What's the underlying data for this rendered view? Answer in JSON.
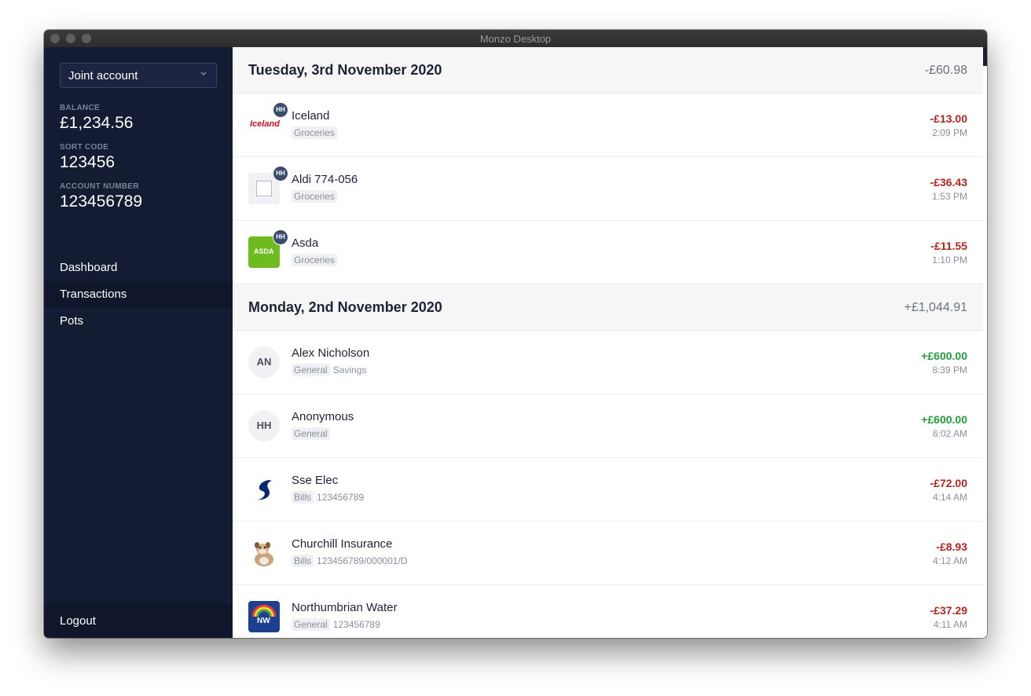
{
  "window": {
    "title": "Monzo Desktop"
  },
  "sidebar": {
    "account_select": "Joint account",
    "balance_label": "BALANCE",
    "balance_value": "£1,234.56",
    "sort_code_label": "SORT CODE",
    "sort_code_value": "123456",
    "account_number_label": "ACCOUNT NUMBER",
    "account_number_value": "123456789",
    "nav": [
      {
        "label": "Dashboard"
      },
      {
        "label": "Transactions",
        "active": true
      },
      {
        "label": "Pots"
      }
    ],
    "logout": "Logout"
  },
  "days": [
    {
      "date": "Tuesday, 3rd November 2020",
      "total": "-£60.98",
      "transactions": [
        {
          "name": "Iceland",
          "tags": [
            "Groceries"
          ],
          "note": "",
          "amount": "-£13.00",
          "time": "2:09 PM",
          "badge": "HH",
          "logo_text": "Iceland",
          "icon": "iceland-logo"
        },
        {
          "name": "Aldi 774-056",
          "tags": [
            "Groceries"
          ],
          "note": "",
          "amount": "-£36.43",
          "time": "1:53 PM",
          "badge": "HH",
          "icon": "placeholder-logo"
        },
        {
          "name": "Asda",
          "tags": [
            "Groceries"
          ],
          "note": "",
          "amount": "-£11.55",
          "time": "1:10 PM",
          "badge": "HH",
          "logo_text": "ASDA",
          "icon": "asda-logo"
        }
      ]
    },
    {
      "date": "Monday, 2nd November 2020",
      "total": "+£1,044.91",
      "transactions": [
        {
          "name": "Alex Nicholson",
          "tags": [
            "General"
          ],
          "note": "Savings",
          "amount": "+£600.00",
          "time": "8:39 PM",
          "initials": "AN"
        },
        {
          "name": "Anonymous",
          "tags": [
            "General"
          ],
          "note": "",
          "amount": "+£600.00",
          "time": "6:02 AM",
          "initials": "HH"
        },
        {
          "name": "Sse Elec",
          "tags": [
            "Bills"
          ],
          "note": "123456789",
          "amount": "-£72.00",
          "time": "4:14 AM",
          "icon": "sse-logo"
        },
        {
          "name": "Churchill Insurance",
          "tags": [
            "Bills"
          ],
          "note": "123456789/000001/D",
          "amount": "-£8.93",
          "time": "4:12 AM",
          "icon": "churchill-dog-logo"
        },
        {
          "name": "Northumbrian Water",
          "tags": [
            "General"
          ],
          "note": "123456789",
          "amount": "-£37.29",
          "time": "4:11 AM",
          "logo_text": "NW",
          "icon": "northumbrian-water-logo"
        }
      ]
    }
  ],
  "colors": {
    "sidebar": "#141c33",
    "negative": "#b3261e",
    "positive": "#1f9e3a"
  }
}
